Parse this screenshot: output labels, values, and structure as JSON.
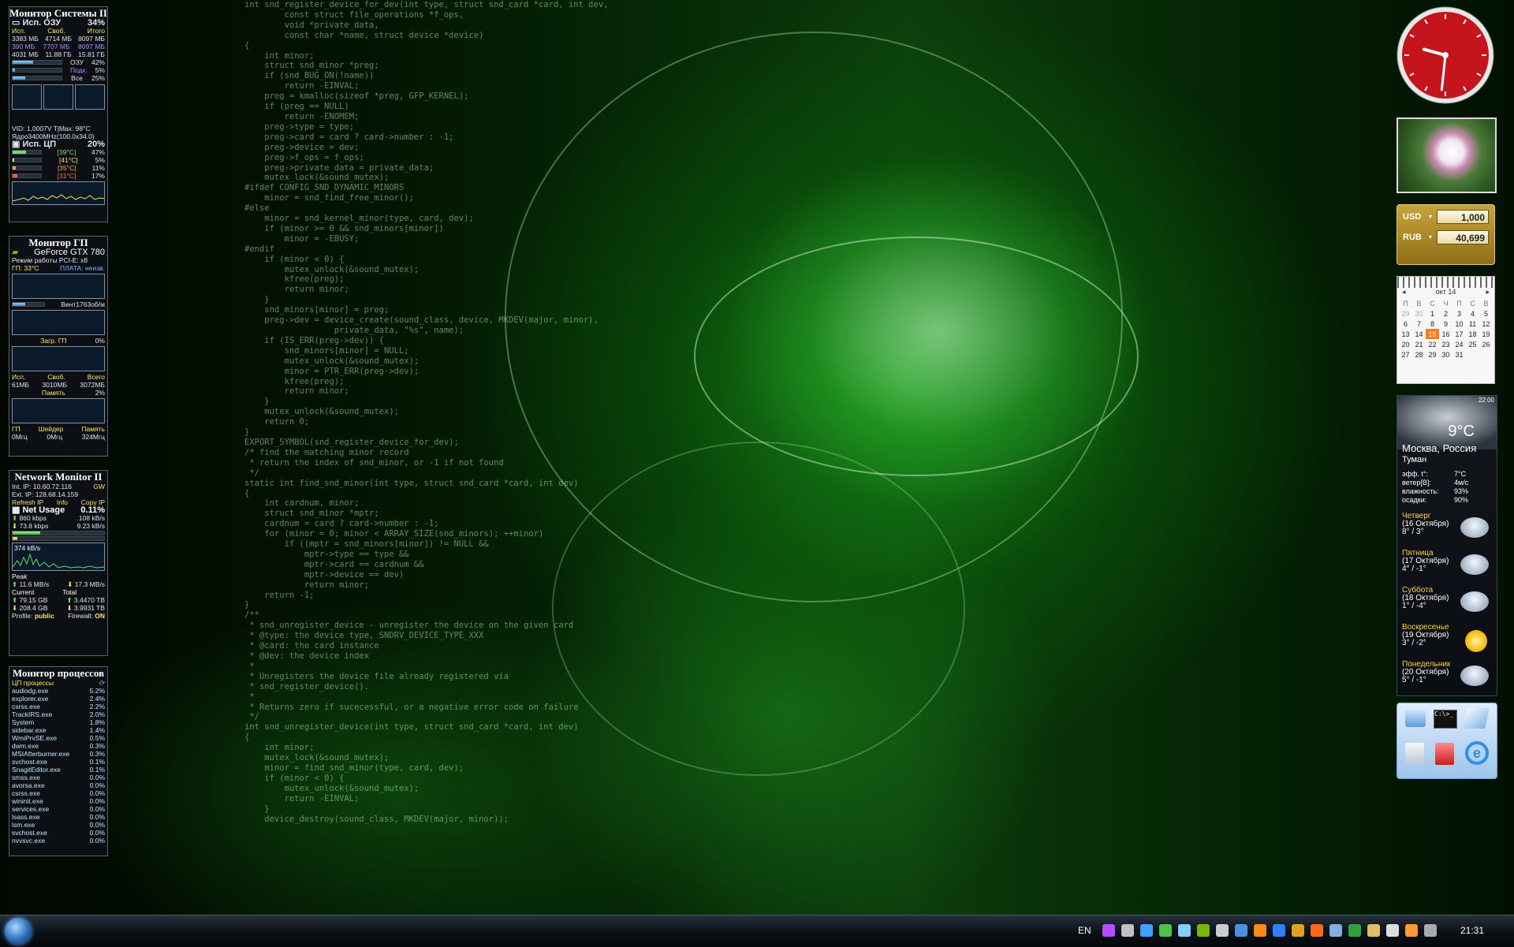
{
  "code_lines": [
    "int snd_register_device_for_dev(int type, struct snd_card *card, int dev,",
    "        const struct file_operations *f_ops,",
    "        void *private_data,",
    "        const char *name, struct device *device)",
    "{",
    "    int minor;",
    "    struct snd_minor *preg;",
    "",
    "    if (snd_BUG_ON(!name))",
    "        return -EINVAL;",
    "    preg = kmalloc(sizeof *preg, GFP_KERNEL);",
    "    if (preg == NULL)",
    "        return -ENOMEM;",
    "    preg->type = type;",
    "    preg->card = card ? card->number : -1;",
    "    preg->device = dev;",
    "    preg->f_ops = f_ops;",
    "    preg->private_data = private_data;",
    "    mutex_lock(&sound_mutex);",
    "#ifdef CONFIG_SND_DYNAMIC_MINORS",
    "    minor = snd_find_free_minor();",
    "#else",
    "    minor = snd_kernel_minor(type, card, dev);",
    "    if (minor >= 0 && snd_minors[minor])",
    "        minor = -EBUSY;",
    "#endif",
    "    if (minor < 0) {",
    "        mutex_unlock(&sound_mutex);",
    "        kfree(preg);",
    "        return minor;",
    "    }",
    "    snd_minors[minor] = preg;",
    "    preg->dev = device_create(sound_class, device, MKDEV(major, minor),",
    "                  private_data, \"%s\", name);",
    "    if (IS_ERR(preg->dev)) {",
    "        snd_minors[minor] = NULL;",
    "        mutex_unlock(&sound_mutex);",
    "        minor = PTR_ERR(preg->dev);",
    "        kfree(preg);",
    "        return minor;",
    "    }",
    "",
    "    mutex_unlock(&sound_mutex);",
    "    return 0;",
    "}",
    "",
    "EXPORT_SYMBOL(snd_register_device_for_dev);",
    "",
    "/* find the matching minor record",
    " * return the index of snd_minor, or -1 if not found",
    " */",
    "static int find_snd_minor(int type, struct snd_card *card, int dev)",
    "{",
    "    int cardnum, minor;",
    "    struct snd_minor *mptr;",
    "",
    "    cardnum = card ? card->number : -1;",
    "    for (minor = 0; minor < ARRAY_SIZE(snd_minors); ++minor)",
    "        if ((mptr = snd_minors[minor]) != NULL &&",
    "            mptr->type == type &&",
    "            mptr->card == cardnum &&",
    "            mptr->device == dev)",
    "            return minor;",
    "    return -1;",
    "}",
    "",
    "/**",
    " * snd_unregister_device - unregister the device on the given card",
    " * @type: the device type, SNDRV_DEVICE_TYPE_XXX",
    " * @card: the card instance",
    " * @dev: the device index",
    " *",
    " * Unregisters the device file already registered via",
    " * snd_register_device().",
    " *",
    " * Returns zero if sucecessful, or a negative error code on failure",
    " */",
    "int snd_unregister_device(int type, struct snd_card *card, int dev)",
    "{",
    "    int minor;",
    "",
    "    mutex_lock(&sound_mutex);",
    "    minor = find_snd_minor(type, card, dev);",
    "    if (minor < 0) {",
    "        mutex_unlock(&sound_mutex);",
    "        return -EINVAL;",
    "    }",
    "",
    "    device_destroy(sound_class, MKDEV(major, minor));"
  ],
  "sysmon": {
    "title": "Монитор Системы II",
    "ram_label": "Исп. ОЗУ",
    "ram_pct": "34%",
    "hdr": [
      "Исп.",
      "Своб.",
      "Итого"
    ],
    "rows": [
      [
        "3383 МБ",
        "4714 МБ",
        "8097 МБ"
      ],
      [
        "390 МБ",
        "7707 МБ",
        "8097 МБ"
      ],
      [
        "4031 МБ",
        "11.88 ГБ",
        "15.81 ГБ"
      ]
    ],
    "bars": [
      {
        "label": "ОЗУ",
        "pct": "42%",
        "fill": 0.42
      },
      {
        "label": "Подк.",
        "pct": "5%",
        "fill": 0.05
      },
      {
        "label": "Все",
        "pct": "25%",
        "fill": 0.25
      }
    ],
    "vid": "VID: 1,0007V TjMax: 98°C",
    "core": "Ядро3400MHz(100.0x34.0)",
    "cpu_label": "Исп. ЦП",
    "cpu_pct": "20%",
    "cores": [
      {
        "temp": "[39°C]",
        "pct": "47%",
        "fill": 0.47
      },
      {
        "temp": "[41°C]",
        "pct": "5%",
        "fill": 0.05
      },
      {
        "temp": "[35°C]",
        "pct": "11%",
        "fill": 0.11
      },
      {
        "temp": "[31°C]",
        "pct": "17%",
        "fill": 0.17
      }
    ]
  },
  "gpumon": {
    "title": "Монитор ГП",
    "card": "GeForce GTX 780",
    "mode": "Режим работы PCI-E: x8",
    "temp": "ГП: 33°C",
    "board": "ПЛАТА: неизв.",
    "fan": "Вент1763об/м",
    "load_label": "Загр. ГП",
    "load_pct": "0%",
    "mem_hdr": [
      "Исп.",
      "Своб.",
      "Всего"
    ],
    "mem_vals": [
      "61МБ",
      "3010МБ",
      "3072МБ"
    ],
    "mem_label": "Память",
    "mem_pct": "2%",
    "clk_hdr": [
      "ГП",
      "Шейдер",
      "Память"
    ],
    "clk_vals": [
      "0Мгц",
      "0Мгц",
      "324Мгц"
    ]
  },
  "netmon": {
    "title": "Network Monitor II",
    "int_ip": "Int. IP: 10.60.72.116",
    "gw": "GW",
    "ext_ip": "Ext. IP: 128.68.14.159",
    "links": [
      "Refresh IP",
      "Info",
      "Copy IP"
    ],
    "usage_label": "Net Usage",
    "usage_pct": "0.11%",
    "up_kbps": "860 kbps",
    "up_kbs": "108 kB/s",
    "down_kbps": "73.8 kbps",
    "down_kbs": "9.23 kB/s",
    "graph_label": "374 kB/s",
    "peak_label": "Peak",
    "peak_up": "11.6 MB/s",
    "peak_down": "17.3 MB/s",
    "current_label": "Current",
    "total_label": "Total",
    "cur_up": "79.15 GB",
    "tot_up": "3.4470 TB",
    "cur_down": "208.4 GB",
    "tot_down": "3.9931 TB",
    "profile_label": "Profile:",
    "profile": "public",
    "firewall_label": "Firewall:",
    "firewall": "ON"
  },
  "procmon": {
    "title": "Монитор процессов",
    "header": "ЦП процессы",
    "items": [
      [
        "audiodg.exe",
        "5.2%"
      ],
      [
        "explorer.exe",
        "2.4%"
      ],
      [
        "csrss.exe",
        "2.2%"
      ],
      [
        "TrackIRS.exe",
        "2.0%"
      ],
      [
        "System",
        "1.8%"
      ],
      [
        "sidebar.exe",
        "1.4%"
      ],
      [
        "WmiPrvSE.exe",
        "0.5%"
      ],
      [
        "dwm.exe",
        "0.3%"
      ],
      [
        "MSIAfterburner.exe",
        "0.3%"
      ],
      [
        "svchost.exe",
        "0.1%"
      ],
      [
        "SnagitEditor.exe",
        "0.1%"
      ],
      [
        "smss.exe",
        "0.0%"
      ],
      [
        "avorsa.exe",
        "0.0%"
      ],
      [
        "csrss.exe",
        "0.0%"
      ],
      [
        "wininit.exe",
        "0.0%"
      ],
      [
        "services.exe",
        "0.0%"
      ],
      [
        "lsass.exe",
        "0.0%"
      ],
      [
        "lsm.exe",
        "0.0%"
      ],
      [
        "svchost.exe",
        "0.0%"
      ],
      [
        "nvvsvc.exe",
        "0.0%"
      ]
    ]
  },
  "clock": {
    "hour": 9,
    "minute": 31
  },
  "currency": {
    "from_code": "USD",
    "from_val": "1,000",
    "to_code": "RUB",
    "to_val": "40,699"
  },
  "calendar": {
    "month": "окт 14",
    "days": [
      "П",
      "В",
      "С",
      "Ч",
      "П",
      "С",
      "В"
    ],
    "weeks": [
      [
        "29",
        "30",
        "1",
        "2",
        "3",
        "4",
        "5"
      ],
      [
        "6",
        "7",
        "8",
        "9",
        "10",
        "11",
        "12"
      ],
      [
        "13",
        "14",
        "15",
        "16",
        "17",
        "18",
        "19"
      ],
      [
        "20",
        "21",
        "22",
        "23",
        "24",
        "25",
        "26"
      ],
      [
        "27",
        "28",
        "29",
        "30",
        "31",
        "",
        ""
      ]
    ],
    "today": "15"
  },
  "weather": {
    "time": "22:00",
    "temp": "9°C",
    "city": "Москва, Россия",
    "cond": "Туман",
    "rows": [
      [
        "эфф. t°:",
        "7°C"
      ],
      [
        "ветер[В]:",
        "4м/с"
      ],
      [
        "влажность:",
        "93%"
      ],
      [
        "осадки:",
        "90%"
      ]
    ],
    "forecast": [
      {
        "day": "Четверг",
        "date": "(16 Октября)",
        "temps": "8° / 3°"
      },
      {
        "day": "Пятница",
        "date": "(17 Октября)",
        "temps": "4° / -1°"
      },
      {
        "day": "Суббота",
        "date": "(18 Октября)",
        "temps": "1° / -4°"
      },
      {
        "day": "Воскресенье",
        "date": "(19 Октября)",
        "temps": "3° / -2°"
      },
      {
        "day": "Понедельник",
        "date": "(20 Октября)",
        "temps": "5° / -1°"
      }
    ]
  },
  "taskbar": {
    "lang": "EN",
    "time": "21:31"
  },
  "colors": {
    "accent": "#2b6cb7",
    "clock_face": "#c4141c",
    "code_green": "#a0e6a0"
  }
}
